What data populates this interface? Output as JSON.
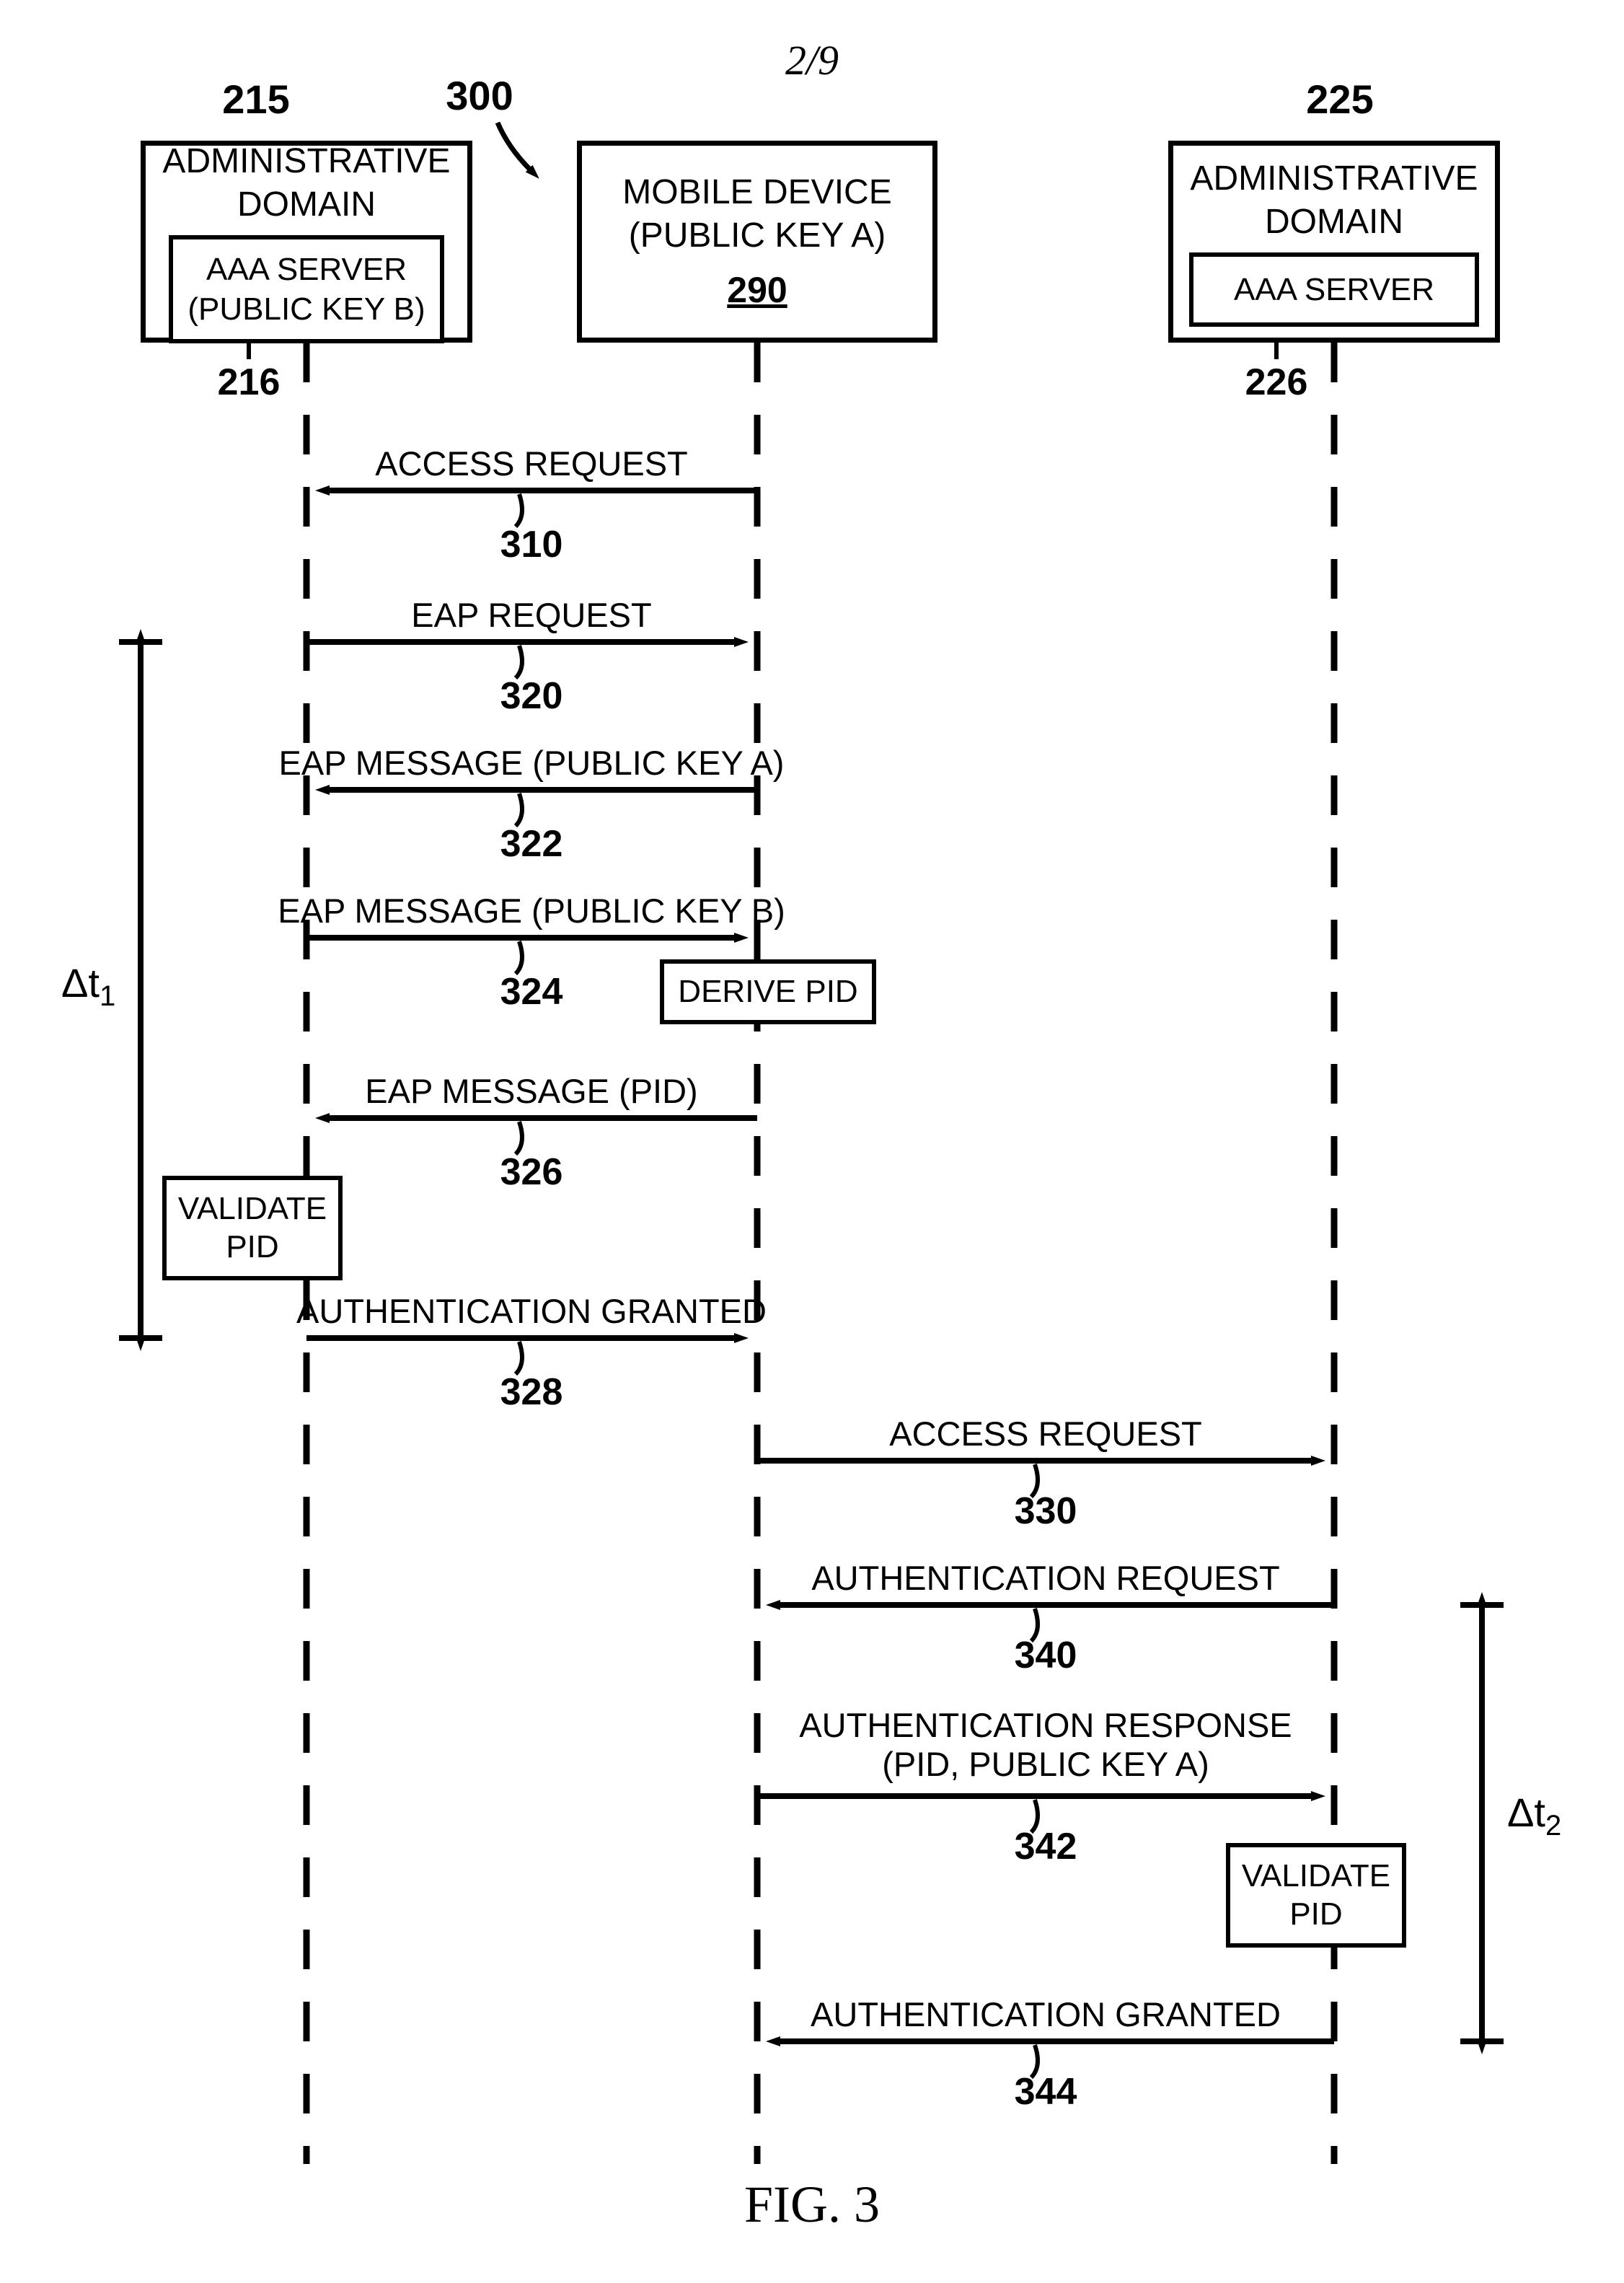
{
  "page_number": "2/9",
  "figure_label": "FIG. 3",
  "diagram_ref": "300",
  "actors": {
    "admin_left": {
      "ref": "215",
      "title": "ADMINISTRATIVE\nDOMAIN",
      "inner": "AAA SERVER\n(PUBLIC KEY B)",
      "inner_ref": "216"
    },
    "mobile": {
      "title": "MOBILE DEVICE\n(PUBLIC KEY A)",
      "ref": "290"
    },
    "admin_right": {
      "ref": "225",
      "title": "ADMINISTRATIVE\nDOMAIN",
      "inner": "AAA SERVER",
      "inner_ref": "226"
    }
  },
  "messages": {
    "m310": {
      "label": "ACCESS REQUEST",
      "ref": "310"
    },
    "m320": {
      "label": "EAP REQUEST",
      "ref": "320"
    },
    "m322": {
      "label": "EAP MESSAGE (PUBLIC KEY A)",
      "ref": "322"
    },
    "m324": {
      "label": "EAP MESSAGE (PUBLIC KEY B)",
      "ref": "324"
    },
    "m326": {
      "label": "EAP MESSAGE (PID)",
      "ref": "326"
    },
    "m328": {
      "label": "AUTHENTICATION GRANTED",
      "ref": "328"
    },
    "m330": {
      "label": "ACCESS REQUEST",
      "ref": "330"
    },
    "m340": {
      "label": "AUTHENTICATION REQUEST",
      "ref": "340"
    },
    "m342": {
      "label": "AUTHENTICATION RESPONSE\n(PID, PUBLIC KEY A)",
      "ref": "342"
    },
    "m344": {
      "label": "AUTHENTICATION GRANTED",
      "ref": "344"
    }
  },
  "process_boxes": {
    "derive_pid": "DERIVE PID",
    "validate_pid_left": "VALIDATE\nPID",
    "validate_pid_right": "VALIDATE\nPID"
  },
  "time_spans": {
    "dt1_prefix": "Δt",
    "dt1_sub": "1",
    "dt2_prefix": "Δt",
    "dt2_sub": "2"
  }
}
